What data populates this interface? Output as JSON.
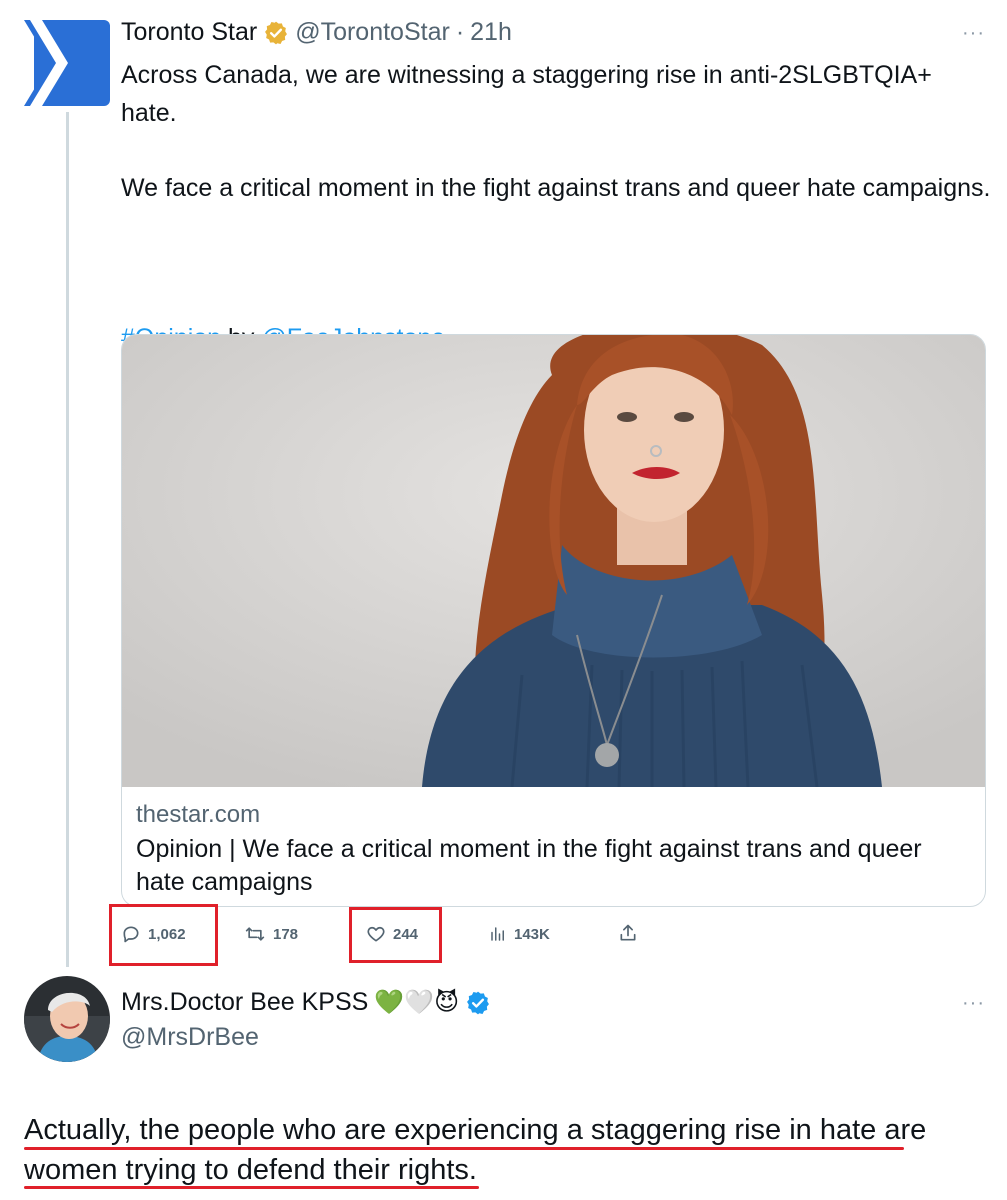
{
  "tweet": {
    "author_name": "Toronto Star",
    "handle": "@TorontoStar",
    "separator": "·",
    "time": "21h",
    "text_main": "Across Canada, we are witnessing a staggering rise in anti-2SLGBTQIA+ hate.\n\nWe face a critical moment in the fight against trans and queer hate campaigns.",
    "hashtag": "#Opinion",
    "by": " by ",
    "mention": "@FaeJohnstone",
    "more": "···",
    "card": {
      "domain": "thestar.com",
      "title": "Opinion | We face a critical moment in the fight against trans and queer hate campaigns"
    },
    "actions": {
      "replies": "1,062",
      "retweets": "178",
      "likes": "244",
      "views": "143K"
    }
  },
  "reply": {
    "author_name": "Mrs.Doctor Bee KPSS",
    "emoji": "💚🤍😈",
    "handle": "@MrsDrBee",
    "more": "···",
    "text_line1": "Actually, the people who are experiencing a staggering rise in hate are",
    "text_line2": "women trying to defend their rights."
  },
  "colors": {
    "link": "#1d9bf0",
    "verified_gold": "#e8b339",
    "verified_blue": "#1d9bf0",
    "highlight_red": "#e0202a",
    "toronto_star_blue": "#2a6fd6"
  },
  "icons": [
    "toronto-star-logo",
    "gold-verified-icon",
    "reply-icon",
    "retweet-icon",
    "like-icon",
    "views-icon",
    "share-icon",
    "blue-verified-icon",
    "more-icon"
  ]
}
